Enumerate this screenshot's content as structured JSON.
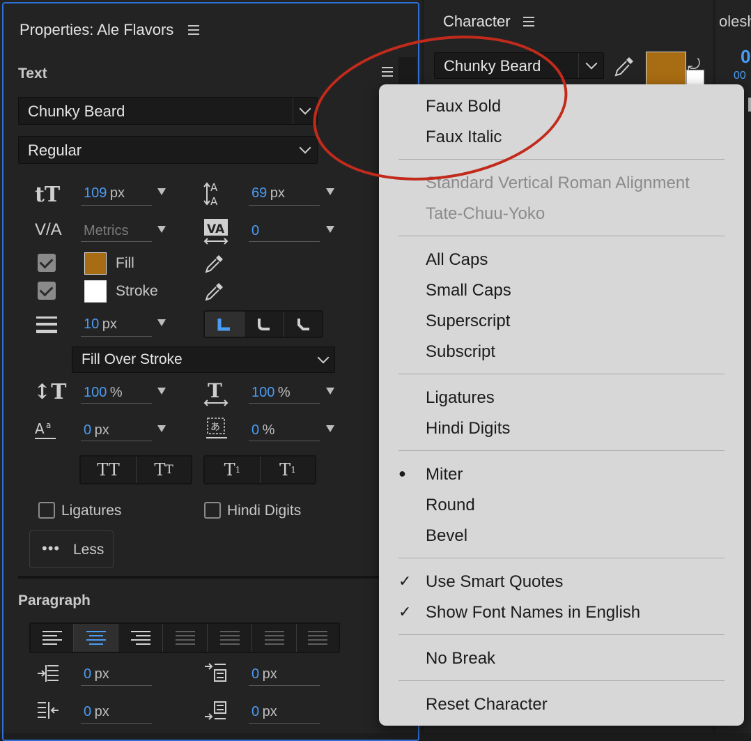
{
  "properties": {
    "title": "Properties: Ale Flavors",
    "text_section": "Text",
    "font": "Chunky Beard",
    "style": "Regular",
    "font_size": {
      "value": "109",
      "unit": "px"
    },
    "leading": {
      "value": "69",
      "unit": "px"
    },
    "kerning": "Metrics",
    "tracking": "0",
    "fill_label": "Fill",
    "stroke_label": "Stroke",
    "stroke_width": {
      "value": "10",
      "unit": "px"
    },
    "stroke_order": "Fill Over Stroke",
    "vertical_scale": {
      "value": "100",
      "unit": "%"
    },
    "horizontal_scale": {
      "value": "100",
      "unit": "%"
    },
    "baseline_shift": {
      "value": "0",
      "unit": "px"
    },
    "tsume": {
      "value": "0",
      "unit": "%"
    },
    "ligatures_label": "Ligatures",
    "hindi_digits_label": "Hindi Digits",
    "less_label": "Less",
    "paragraph_section": "Paragraph",
    "indent_left": {
      "value": "0",
      "unit": "px"
    },
    "space_before": {
      "value": "0",
      "unit": "px"
    },
    "indent_right": {
      "value": "0",
      "unit": "px"
    },
    "space_after": {
      "value": "0",
      "unit": "px"
    }
  },
  "character": {
    "title": "Character",
    "font": "Chunky Beard",
    "right_tab_partial": "olesh"
  },
  "colors": {
    "fill": "#a86c12",
    "stroke": "#ffffff",
    "accent": "#4a9cf5",
    "highlight_ellipse": "#c22b1c"
  },
  "menu": {
    "items": [
      {
        "label": "Faux Bold"
      },
      {
        "label": "Faux Italic"
      },
      {
        "label": "Standard Vertical Roman Alignment",
        "disabled": true
      },
      {
        "label": "Tate-Chuu-Yoko",
        "disabled": true
      },
      {
        "label": "All Caps"
      },
      {
        "label": "Small Caps"
      },
      {
        "label": "Superscript"
      },
      {
        "label": "Subscript"
      },
      {
        "label": "Ligatures"
      },
      {
        "label": "Hindi Digits"
      },
      {
        "label": "Miter",
        "mark": "●"
      },
      {
        "label": "Round"
      },
      {
        "label": "Bevel"
      },
      {
        "label": "Use Smart Quotes",
        "mark": "✓"
      },
      {
        "label": "Show Font Names in English",
        "mark": "✓"
      },
      {
        "label": "No Break"
      },
      {
        "label": "Reset Character"
      }
    ]
  }
}
